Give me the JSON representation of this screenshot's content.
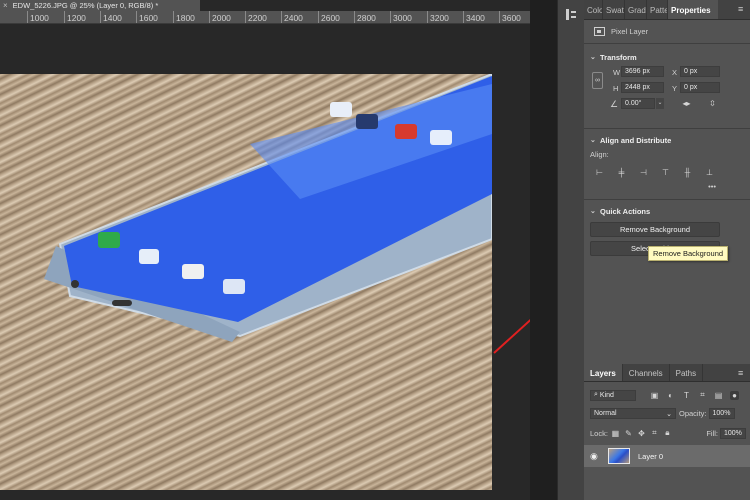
{
  "document": {
    "tab_title": "EDW_5226.JPG @ 25% (Layer 0, RGB/8) *",
    "tab_close": "×",
    "ruler_ticks": [
      "1000",
      "1200",
      "1400",
      "1600",
      "1800",
      "2000",
      "2200",
      "2400",
      "2600",
      "2800",
      "3000",
      "3200",
      "3400",
      "3600"
    ]
  },
  "phone_screen": {
    "color": "#2f5fe8"
  },
  "panel_tabs": [
    "Colo",
    "Swat",
    "Grad",
    "Patte",
    "Properties"
  ],
  "properties": {
    "layer_kind": "Pixel Layer",
    "transform_title": "Transform",
    "w_label": "W",
    "w_value": "3696 px",
    "h_label": "H",
    "h_value": "2448 px",
    "x_label": "X",
    "x_value": "0 px",
    "y_label": "Y",
    "y_value": "0 px",
    "angle_value": "0.00°",
    "align_title": "Align and Distribute",
    "align_label": "Align:",
    "more": "•••",
    "quick_actions_title": "Quick Actions",
    "remove_bg_label": "Remove Background",
    "select_subject_label": "Select Subject",
    "tooltip_text": "Remove Background"
  },
  "layers": {
    "tabs": [
      "Layers",
      "Channels",
      "Paths"
    ],
    "kind_label": "Kind",
    "blend_mode": "Normal",
    "opacity_label": "Opacity:",
    "opacity_value": "100%",
    "lock_label": "Lock:",
    "fill_label": "Fill:",
    "fill_value": "100%",
    "layer_name": "Layer 0"
  },
  "colors": {
    "accent_arrow": "#e02020",
    "tooltip_bg": "#fffac0"
  }
}
